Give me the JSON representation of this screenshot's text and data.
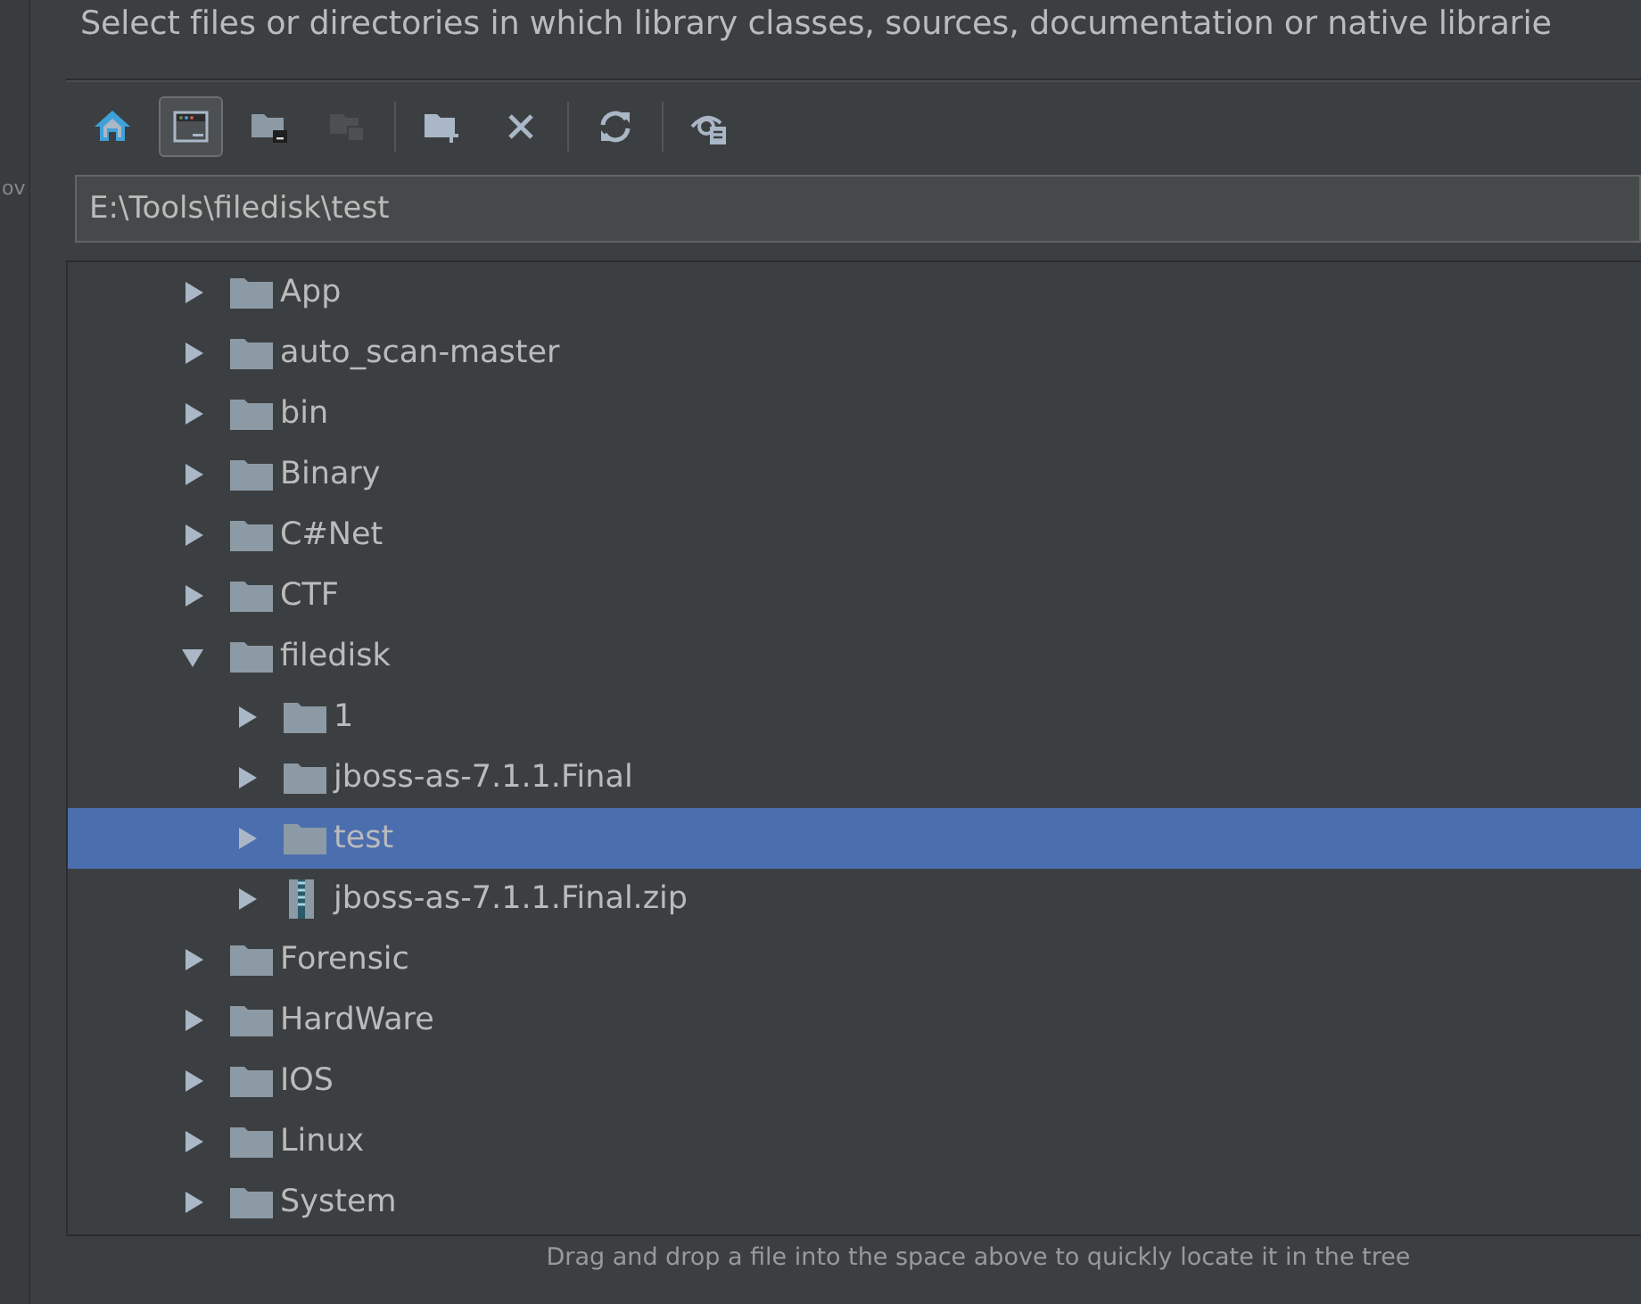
{
  "side_text": "ov",
  "description": "Select files or directories in which library classes, sources, documentation or native librarie",
  "toolbar": [
    {
      "kind": "home",
      "pressed": false,
      "disabled": false
    },
    {
      "kind": "window",
      "pressed": true,
      "disabled": false
    },
    {
      "kind": "folder-hide",
      "pressed": false,
      "disabled": false
    },
    {
      "kind": "folder-stack",
      "pressed": false,
      "disabled": true
    },
    {
      "kind": "separator"
    },
    {
      "kind": "new-folder",
      "pressed": false,
      "disabled": false
    },
    {
      "kind": "delete",
      "pressed": false,
      "disabled": false
    },
    {
      "kind": "separator"
    },
    {
      "kind": "refresh",
      "pressed": false,
      "disabled": false
    },
    {
      "kind": "separator"
    },
    {
      "kind": "show-hidden",
      "pressed": false,
      "disabled": false
    }
  ],
  "path": "E:\\Tools\\filedisk\\test",
  "tree": [
    {
      "label": "App",
      "kind": "folder",
      "expanded": false,
      "selected": false
    },
    {
      "label": "auto_scan-master",
      "kind": "folder",
      "expanded": false,
      "selected": false
    },
    {
      "label": "bin",
      "kind": "folder",
      "expanded": false,
      "selected": false
    },
    {
      "label": "Binary",
      "kind": "folder",
      "expanded": false,
      "selected": false
    },
    {
      "label": "C#Net",
      "kind": "folder",
      "expanded": false,
      "selected": false
    },
    {
      "label": "CTF",
      "kind": "folder",
      "expanded": false,
      "selected": false
    },
    {
      "label": "filedisk",
      "kind": "folder",
      "expanded": true,
      "selected": false,
      "children": [
        {
          "label": "1",
          "kind": "folder",
          "expanded": false,
          "selected": false
        },
        {
          "label": "jboss-as-7.1.1.Final",
          "kind": "folder",
          "expanded": false,
          "selected": false
        },
        {
          "label": "test",
          "kind": "folder",
          "expanded": false,
          "selected": true
        },
        {
          "label": "jboss-as-7.1.1.Final.zip",
          "kind": "zip",
          "expanded": false,
          "selected": false
        }
      ]
    },
    {
      "label": "Forensic",
      "kind": "folder",
      "expanded": false,
      "selected": false
    },
    {
      "label": "HardWare",
      "kind": "folder",
      "expanded": false,
      "selected": false
    },
    {
      "label": "IOS",
      "kind": "folder",
      "expanded": false,
      "selected": false
    },
    {
      "label": "Linux",
      "kind": "folder",
      "expanded": false,
      "selected": false
    },
    {
      "label": "System",
      "kind": "folder",
      "expanded": false,
      "selected": false
    }
  ],
  "hint": "Drag and drop a file into the space above to quickly locate it in the tree"
}
